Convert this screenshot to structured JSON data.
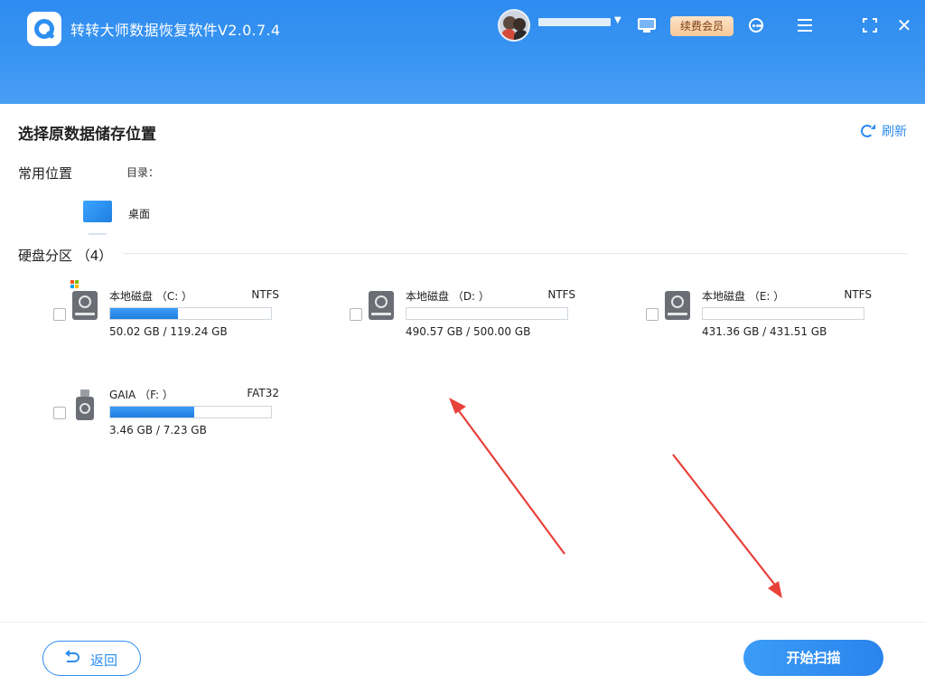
{
  "app": {
    "title": "转转大师数据恢复软件V2.0.7.4",
    "vip_label": "续费会员"
  },
  "main": {
    "section_title": "选择原数据储存位置",
    "refresh_label": "刷新",
    "common_locations_label": "常用位置",
    "directory_label": "目录：",
    "desktop_label": "桌面",
    "disk_section_label": "硬盘分区 （4）"
  },
  "disks": [
    {
      "name": "本地磁盘 （C: ）",
      "fs": "NTFS",
      "size": "50.02 GB / 119.24 GB",
      "used_fraction": 0.42,
      "type": "system"
    },
    {
      "name": "本地磁盘 （D: ）",
      "fs": "NTFS",
      "size": "490.57 GB / 500.00 GB",
      "used_fraction": 0.0,
      "type": "hdd"
    },
    {
      "name": "本地磁盘 （E: ）",
      "fs": "NTFS",
      "size": "431.36 GB / 431.51 GB",
      "used_fraction": 0.0,
      "type": "hdd"
    },
    {
      "name": "GAIA （F: ）",
      "fs": "FAT32",
      "size": "3.46 GB / 7.23 GB",
      "used_fraction": 0.52,
      "type": "usb"
    }
  ],
  "footer": {
    "back_label": "返回",
    "scan_label": "开始扫描"
  },
  "colors": {
    "accent": "#2d8cf0",
    "arrow": "#e8403a",
    "vip_text": "#7a3d12"
  }
}
